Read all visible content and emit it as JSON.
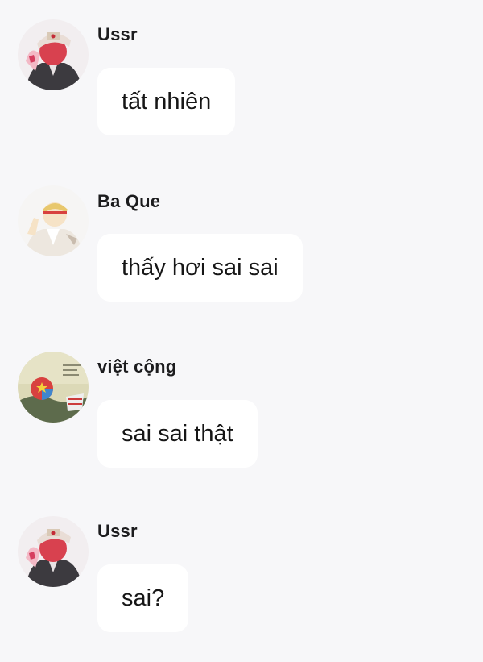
{
  "messages": [
    {
      "sender": "Ussr",
      "text": "tất nhiên",
      "avatar_icon": "ussr-avatar-icon"
    },
    {
      "sender": "Ba Que",
      "text": "thấy hơi sai sai",
      "avatar_icon": "ba-que-avatar-icon"
    },
    {
      "sender": "việt cộng",
      "text": "sai sai thật",
      "avatar_icon": "viet-cong-avatar-icon"
    },
    {
      "sender": "Ussr",
      "text": "sai?",
      "avatar_icon": "ussr-avatar-icon"
    }
  ],
  "colors": {
    "background": "#f7f7f9",
    "bubble": "#ffffff",
    "text": "#161616"
  }
}
